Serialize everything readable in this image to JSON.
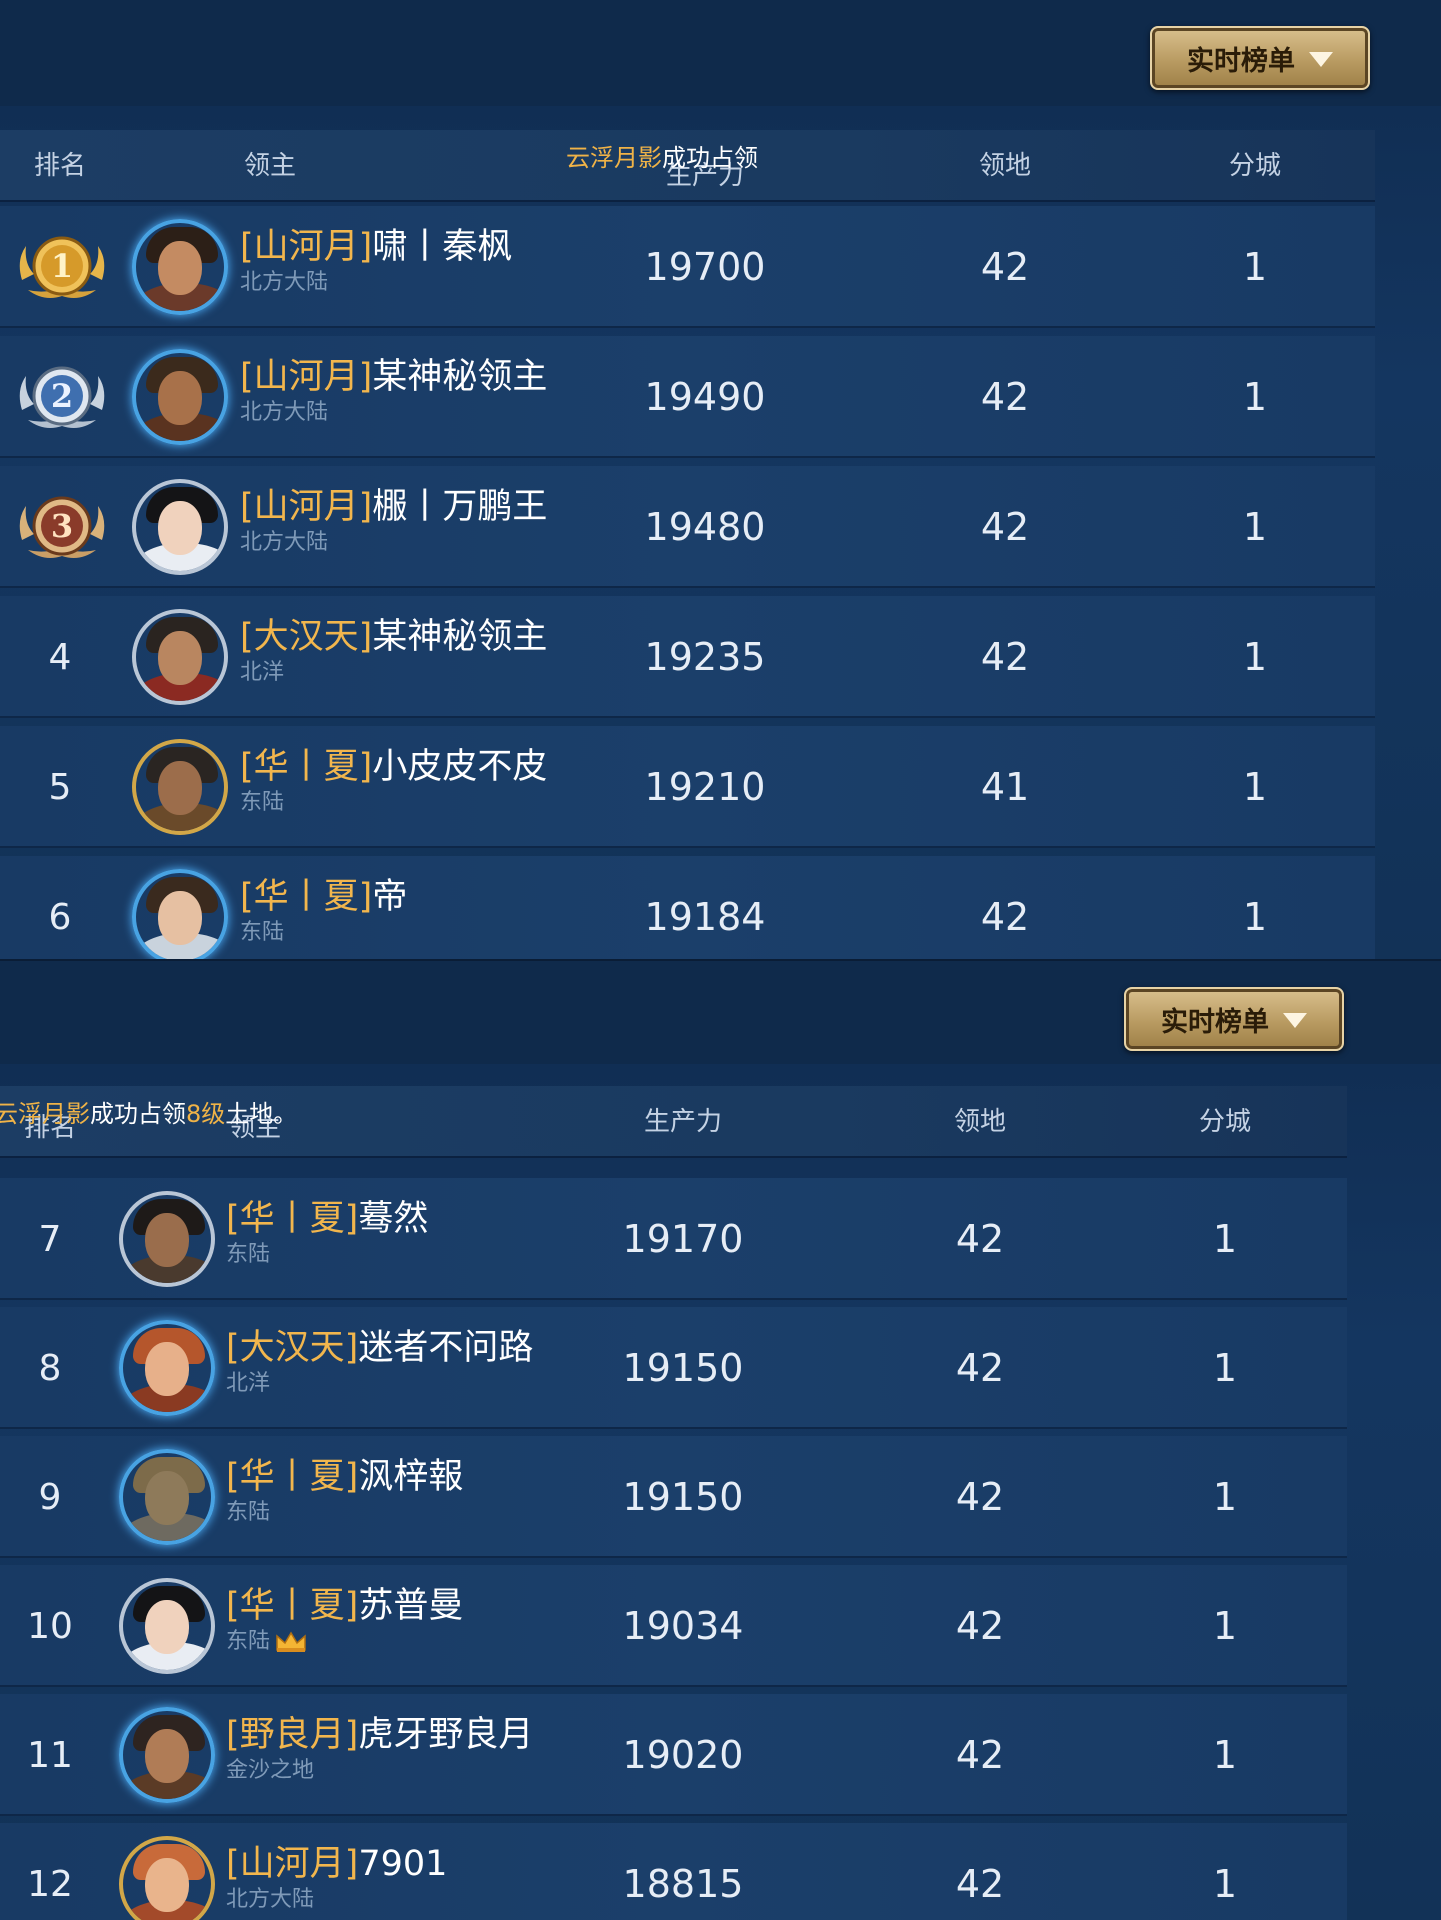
{
  "top_panel": {
    "dropdown_label": "实时榜单",
    "headers": {
      "rank": "排名",
      "lord": "领主",
      "power": "生产力",
      "territory": "领地",
      "branch": "分城"
    },
    "ticker": {
      "name": "云浮月影",
      "text": "成功占领"
    },
    "rows": [
      {
        "rank": "1",
        "alliance": "[山河月]",
        "name": "啸丨秦枫",
        "region": "北方大陆",
        "power": "19700",
        "territory": "42",
        "branch": "1"
      },
      {
        "rank": "2",
        "alliance": "[山河月]",
        "name": "某神秘领主",
        "region": "北方大陆",
        "power": "19490",
        "territory": "42",
        "branch": "1"
      },
      {
        "rank": "3",
        "alliance": "[山河月]",
        "name": "棴丨万鹏王",
        "region": "北方大陆",
        "power": "19480",
        "territory": "42",
        "branch": "1"
      },
      {
        "rank": "4",
        "alliance": "[大汉天]",
        "name": "某神秘领主",
        "region": "北洋",
        "power": "19235",
        "territory": "42",
        "branch": "1"
      },
      {
        "rank": "5",
        "alliance": "[华丨夏]",
        "name": "小皮皮不皮",
        "region": "东陆",
        "power": "19210",
        "territory": "41",
        "branch": "1"
      },
      {
        "rank": "6",
        "alliance": "[华丨夏]",
        "name": "帝",
        "region": "东陆",
        "power": "19184",
        "territory": "42",
        "branch": "1"
      }
    ]
  },
  "bottom_panel": {
    "dropdown_label": "实时榜单",
    "headers": {
      "rank": "排名",
      "lord": "领主",
      "power": "生产力",
      "territory": "领地",
      "branch": "分城"
    },
    "ticker": {
      "name": "云浮月影",
      "text_before": "成功占领",
      "level": "8级",
      "text_after": "土地。"
    },
    "rows": [
      {
        "rank": "7",
        "alliance": "[华丨夏]",
        "name": "蓦然",
        "region": "东陆",
        "power": "19170",
        "territory": "42",
        "branch": "1"
      },
      {
        "rank": "8",
        "alliance": "[大汉天]",
        "name": "迷者不问路",
        "region": "北洋",
        "power": "19150",
        "territory": "42",
        "branch": "1"
      },
      {
        "rank": "9",
        "alliance": "[华丨夏]",
        "name": "沨梓報",
        "region": "东陆",
        "power": "19150",
        "territory": "42",
        "branch": "1"
      },
      {
        "rank": "10",
        "alliance": "[华丨夏]",
        "name": "苏普曼",
        "region": "东陆",
        "power": "19034",
        "territory": "42",
        "branch": "1"
      },
      {
        "rank": "11",
        "alliance": "[野良月]",
        "name": "虎牙野良月",
        "region": "金沙之地",
        "power": "19020",
        "territory": "42",
        "branch": "1"
      },
      {
        "rank": "12",
        "alliance": "[山河月]",
        "name": "7901",
        "region": "北方大陆",
        "power": "18815",
        "territory": "42",
        "branch": "1"
      }
    ]
  },
  "colors": {
    "alliance": "#f2b64d",
    "medal_gold": "#e0a93b",
    "medal_silver": "#4a78b8",
    "medal_bronze": "#8a3b2a"
  }
}
